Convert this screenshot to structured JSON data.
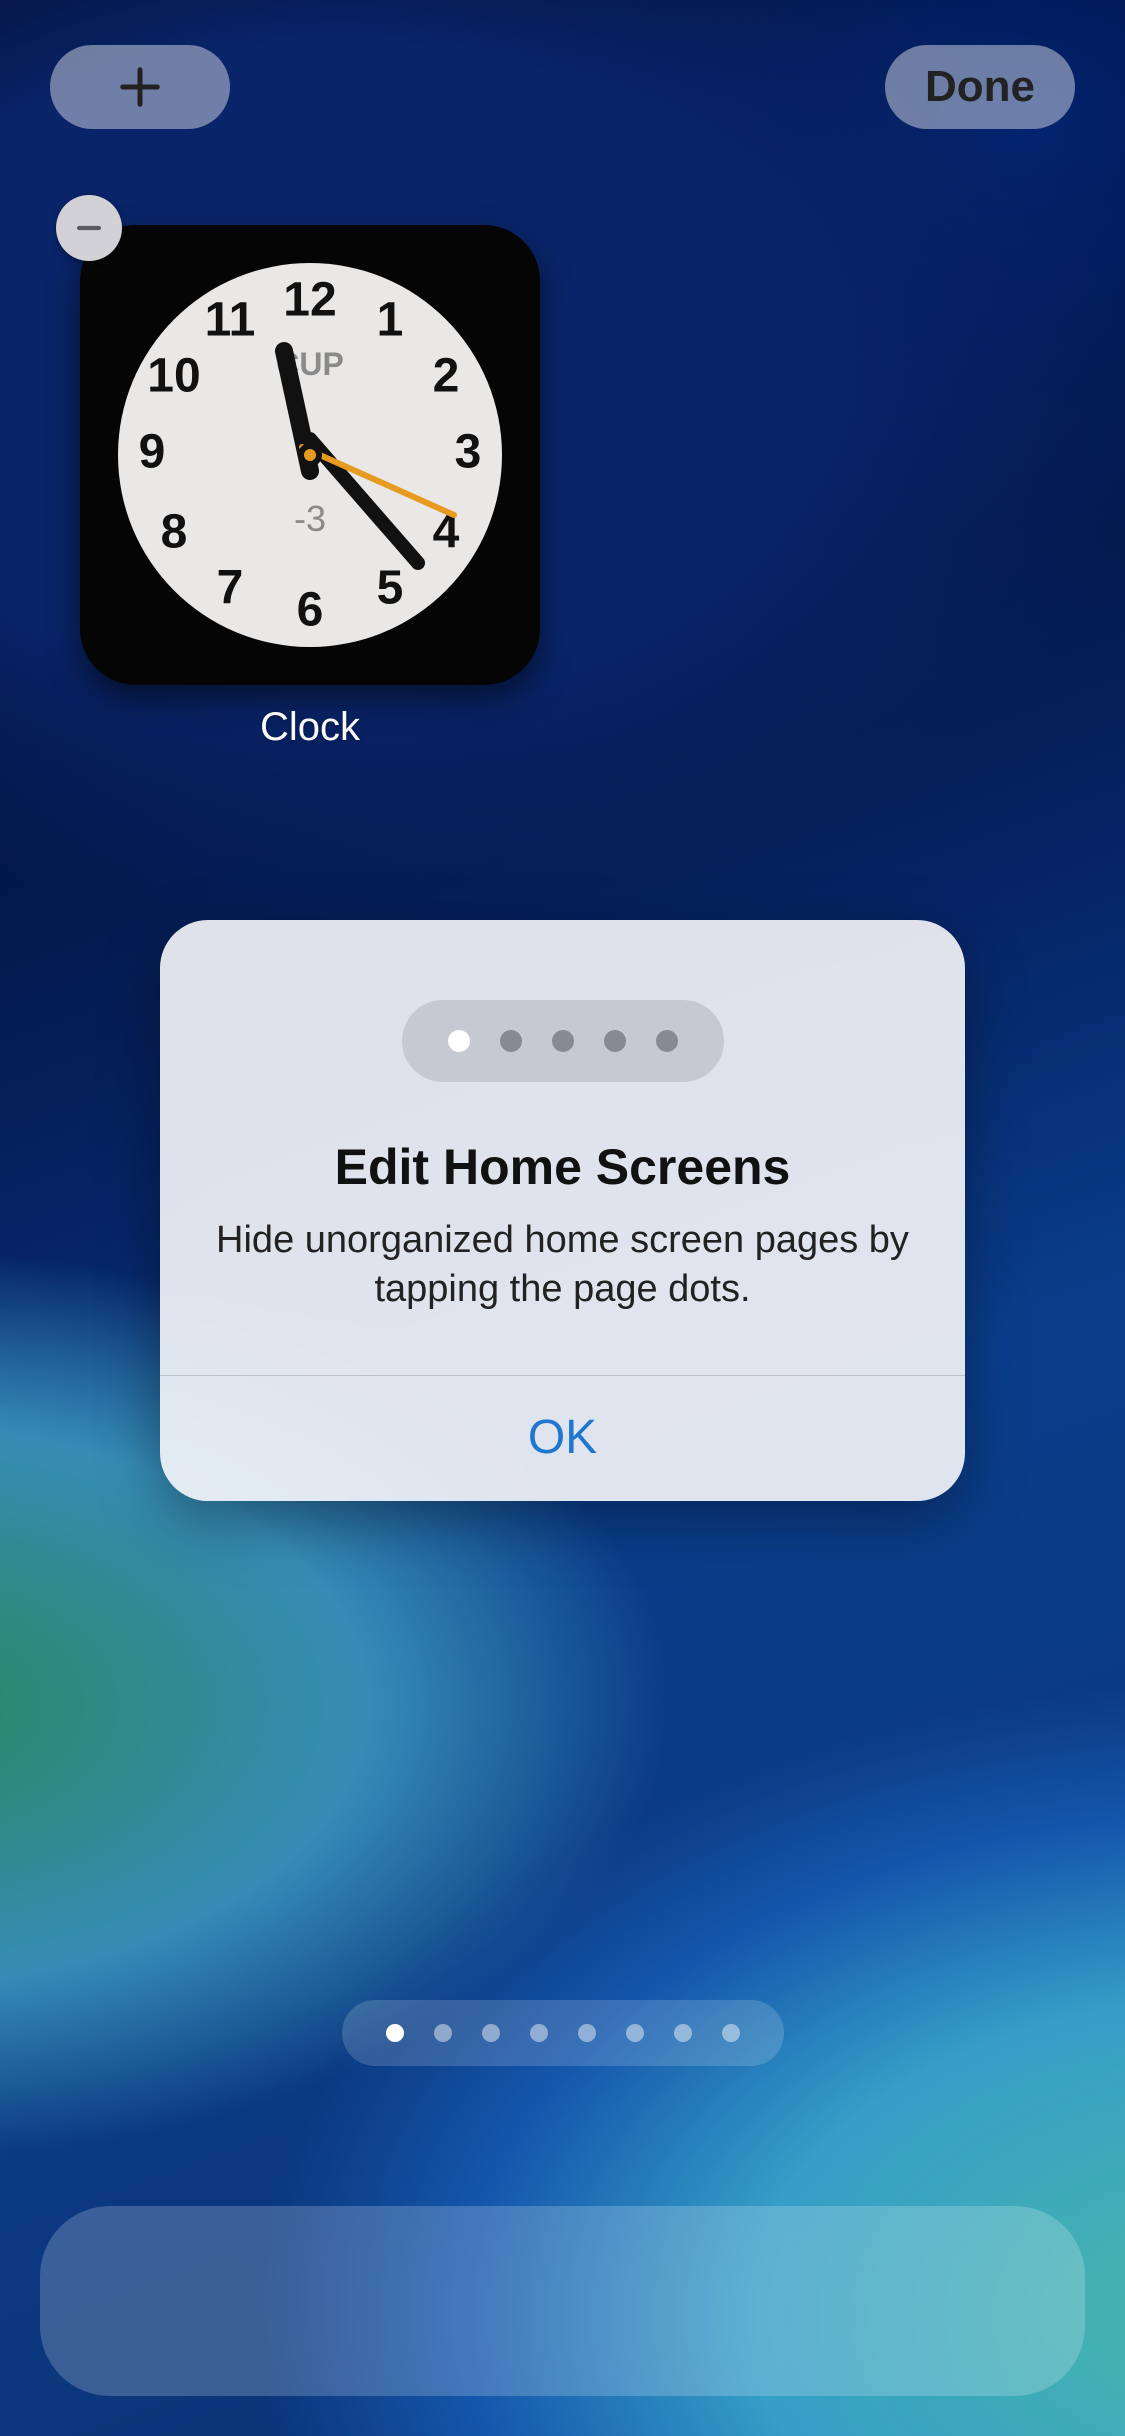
{
  "header": {
    "add_label": "+",
    "done_label": "Done"
  },
  "widget": {
    "label": "Clock",
    "city_code": "CUP",
    "offset": "-3",
    "hours": [
      1,
      2,
      3,
      4,
      5,
      6,
      7,
      8,
      9,
      10,
      11,
      12
    ],
    "time": {
      "hour": 11,
      "minute": 23,
      "second": 20
    }
  },
  "modal": {
    "title": "Edit Home Screens",
    "body": "Hide unorganized home screen pages by tapping the page dots.",
    "ok_label": "OK",
    "preview_dots": 5,
    "preview_active": 0
  },
  "page_indicator": {
    "count": 8,
    "active": 0
  }
}
